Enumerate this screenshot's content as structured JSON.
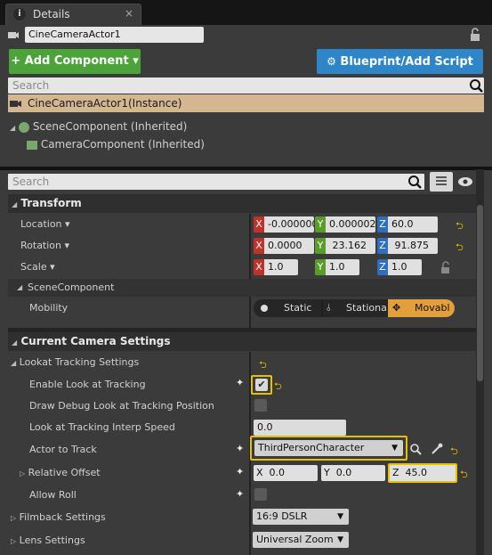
{
  "tab": {
    "icon": "i",
    "label": "Details",
    "close": "×"
  },
  "name_field": "CineCameraActor1",
  "buttons": {
    "add_component": "+ Add Component ▾",
    "blueprint": "Blueprint/Add Script"
  },
  "component_search": {
    "placeholder": "Search"
  },
  "components": {
    "instance": "CineCameraActor1(Instance)",
    "scene": "SceneComponent (Inherited)",
    "camera": "CameraComponent (Inherited)"
  },
  "details_search": {
    "placeholder": "Search"
  },
  "transform": {
    "header": "Transform",
    "location": {
      "label": "Location ▾",
      "x": "-0.000000",
      "y": "0.000002",
      "z": "60.0"
    },
    "rotation": {
      "label": "Rotation ▾",
      "x": "0.0000",
      "y": "23.162",
      "z": "91.875"
    },
    "scale": {
      "label": "Scale ▾",
      "x": "1.0",
      "y": "1.0",
      "z": "1.0"
    },
    "axis": {
      "x": "X",
      "y": "Y",
      "z": "Z"
    },
    "scene_component": "SceneComponent",
    "mobility": {
      "label": "Mobility",
      "static": "Static",
      "stationary": "Stationa",
      "movable": "Movabl"
    }
  },
  "camera_settings": {
    "header": "Current Camera Settings",
    "lookat": "Lookat Tracking Settings",
    "enable_look": "Enable Look at Tracking",
    "draw_debug": "Draw Debug Look at Tracking Position",
    "interp_label": "Look at Tracking Interp Speed",
    "interp_value": "0.0",
    "actor_label": "Actor to Track",
    "actor_value": "ThirdPersonCharacter",
    "offset_label": "Relative Offset",
    "offset": {
      "x": "0.0",
      "y": "0.0",
      "z": "45.0"
    },
    "allow_roll": "Allow Roll",
    "filmback_label": "Filmback Settings",
    "filmback_value": "16:9 DSLR",
    "lens_label": "Lens Settings",
    "lens_value": "Universal Zoom"
  },
  "colors": {
    "accent_green": "#4ba33a",
    "accent_blue": "#2e86c9",
    "highlight": "#d4b690",
    "movable": "#e3a03a",
    "selection_border": "#e5c100"
  }
}
